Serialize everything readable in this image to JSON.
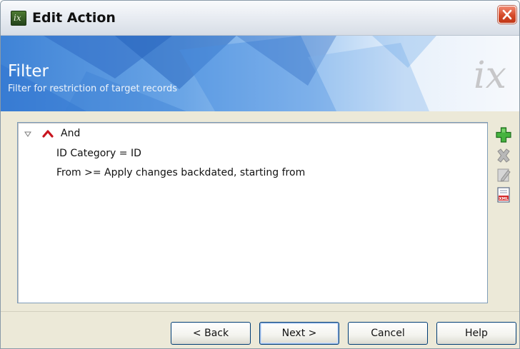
{
  "window": {
    "title": "Edit Action",
    "app_icon_text": "ix"
  },
  "banner": {
    "title": "Filter",
    "subtitle": "Filter for restriction of target records",
    "logo": "ix"
  },
  "filter_tree": {
    "root": {
      "expander_icon": "triangle-down-icon",
      "icon": "caret-up-icon",
      "label": "And"
    },
    "conditions": [
      "ID Category = ID",
      "From >= Apply changes backdated, starting from"
    ]
  },
  "side_toolbar": [
    {
      "name": "add-condition",
      "icon": "plus-icon",
      "enabled": true
    },
    {
      "name": "delete-condition",
      "icon": "delete-x-icon",
      "enabled": false
    },
    {
      "name": "edit-condition",
      "icon": "edit-icon",
      "enabled": false
    },
    {
      "name": "xml-export",
      "icon": "xml-icon",
      "enabled": true
    }
  ],
  "footer": {
    "back_label": "< Back",
    "next_label": "Next >",
    "cancel_label": "Cancel",
    "help_label": "Help"
  },
  "colors": {
    "banner_blue": "#3f83d6",
    "add_green": "#3aa63a",
    "caret_red": "#c8141e",
    "close_red": "#d44a2a"
  }
}
